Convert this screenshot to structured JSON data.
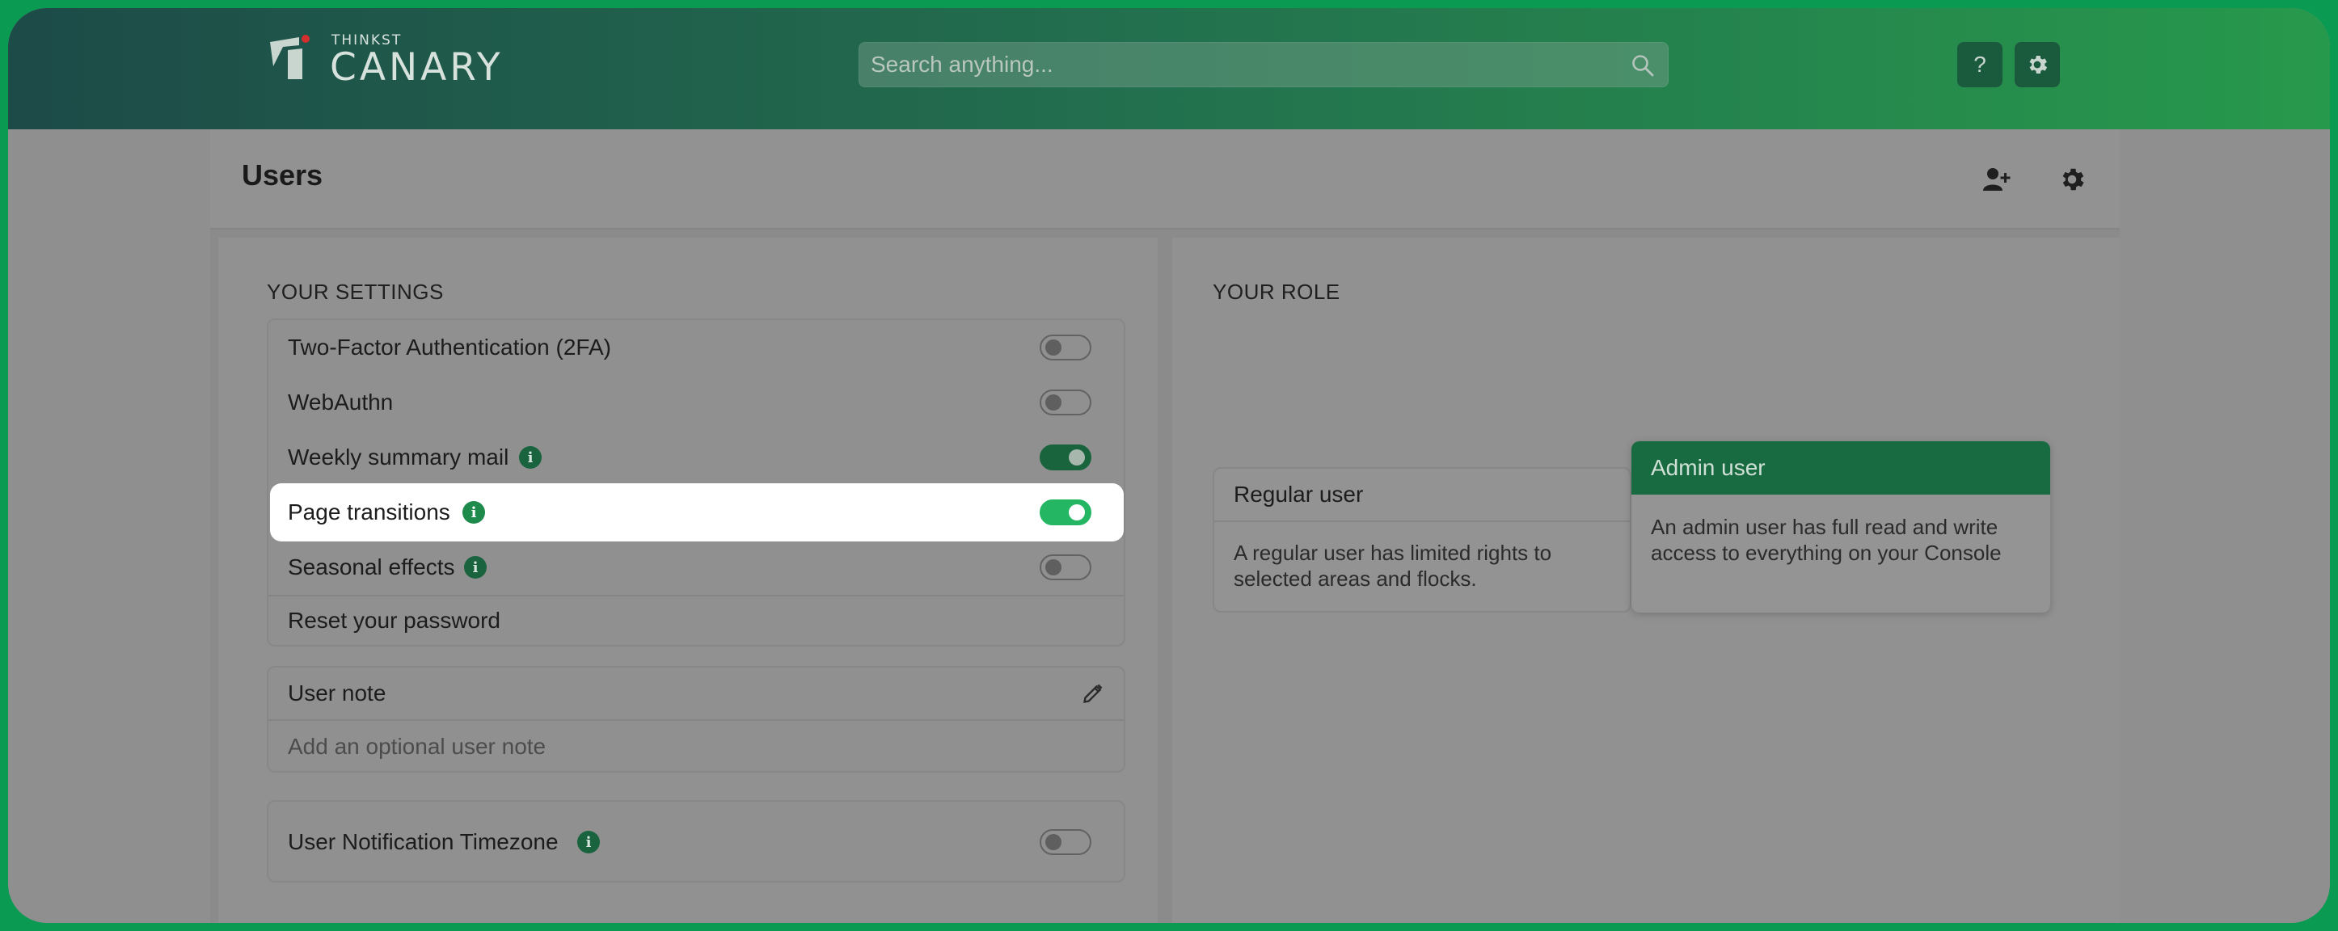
{
  "header": {
    "logo_small": "THINKST",
    "logo_big": "CANARY",
    "search_placeholder": "Search anything...",
    "help_label": "?",
    "colors": {
      "gradient_start": "#1d4b48",
      "gradient_end": "#27994c",
      "brand_red": "#d32f2f"
    }
  },
  "page": {
    "title": "Users",
    "icons": [
      "add-user-icon",
      "settings-icon"
    ]
  },
  "settings": {
    "section_title": "YOUR SETTINGS",
    "items": [
      {
        "label": "Two-Factor Authentication (2FA)",
        "toggle": false,
        "info": false
      },
      {
        "label": "WebAuthn",
        "toggle": false,
        "info": false
      },
      {
        "label": "Weekly summary mail",
        "toggle": true,
        "info": true
      },
      {
        "label": "Page transitions",
        "toggle": true,
        "info": true,
        "highlighted": true
      },
      {
        "label": "Seasonal effects",
        "toggle": false,
        "info": true
      },
      {
        "label": "Reset your password"
      }
    ],
    "user_note": {
      "title": "User note",
      "placeholder": "Add an optional user note"
    },
    "timezone": {
      "label": "User Notification Timezone",
      "toggle": false
    }
  },
  "role": {
    "section_title": "YOUR ROLE",
    "regular": {
      "title": "Regular user",
      "description": "A regular user has limited rights to selected areas and flocks."
    },
    "admin": {
      "title": "Admin user",
      "description": "An admin user has full read and write access to everything on your Console",
      "selected": true
    }
  }
}
